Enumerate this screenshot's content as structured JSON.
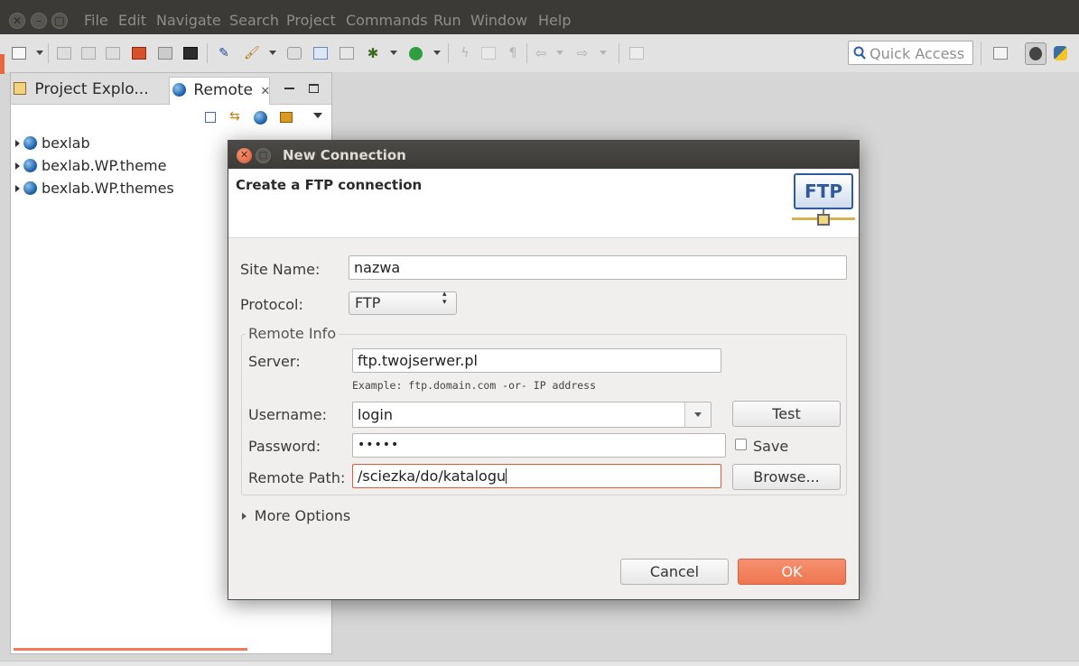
{
  "menubar": {
    "items": [
      "File",
      "Edit",
      "Navigate",
      "Search",
      "Project",
      "Commands",
      "Run",
      "Window",
      "Help"
    ]
  },
  "toolbar": {
    "quick_access_placeholder": "Quick Access"
  },
  "explorer": {
    "tabs": [
      {
        "label": "Project Explo..."
      },
      {
        "label": "Remote",
        "close": "✕"
      }
    ],
    "tree": [
      {
        "label": "bexlab"
      },
      {
        "label": "bexlab.WP.theme"
      },
      {
        "label": "bexlab.WP.themes"
      }
    ]
  },
  "dialog": {
    "title": "New Connection",
    "header": "Create a FTP connection",
    "logo_text": "FTP",
    "site_name_label": "Site Name:",
    "site_name_value": "nazwa",
    "protocol_label": "Protocol:",
    "protocol_value": "FTP",
    "remote_info_label": "Remote Info",
    "server_label": "Server:",
    "server_value": "ftp.twojserwer.pl",
    "server_hint": "Example: ftp.domain.com -or- IP address",
    "username_label": "Username:",
    "username_value": "login",
    "test_button": "Test",
    "password_label": "Password:",
    "password_value": "•••••",
    "save_label": "Save",
    "save_checked": false,
    "remote_path_label": "Remote Path:",
    "remote_path_value": "/sciezka/do/katalogu",
    "browse_button": "Browse...",
    "more_options": "More Options",
    "cancel_button": "Cancel",
    "ok_button": "OK"
  },
  "colors": {
    "accent": "#f0795a",
    "menubar_bg": "#3b3a36",
    "focus_border": "#e05a3a"
  }
}
